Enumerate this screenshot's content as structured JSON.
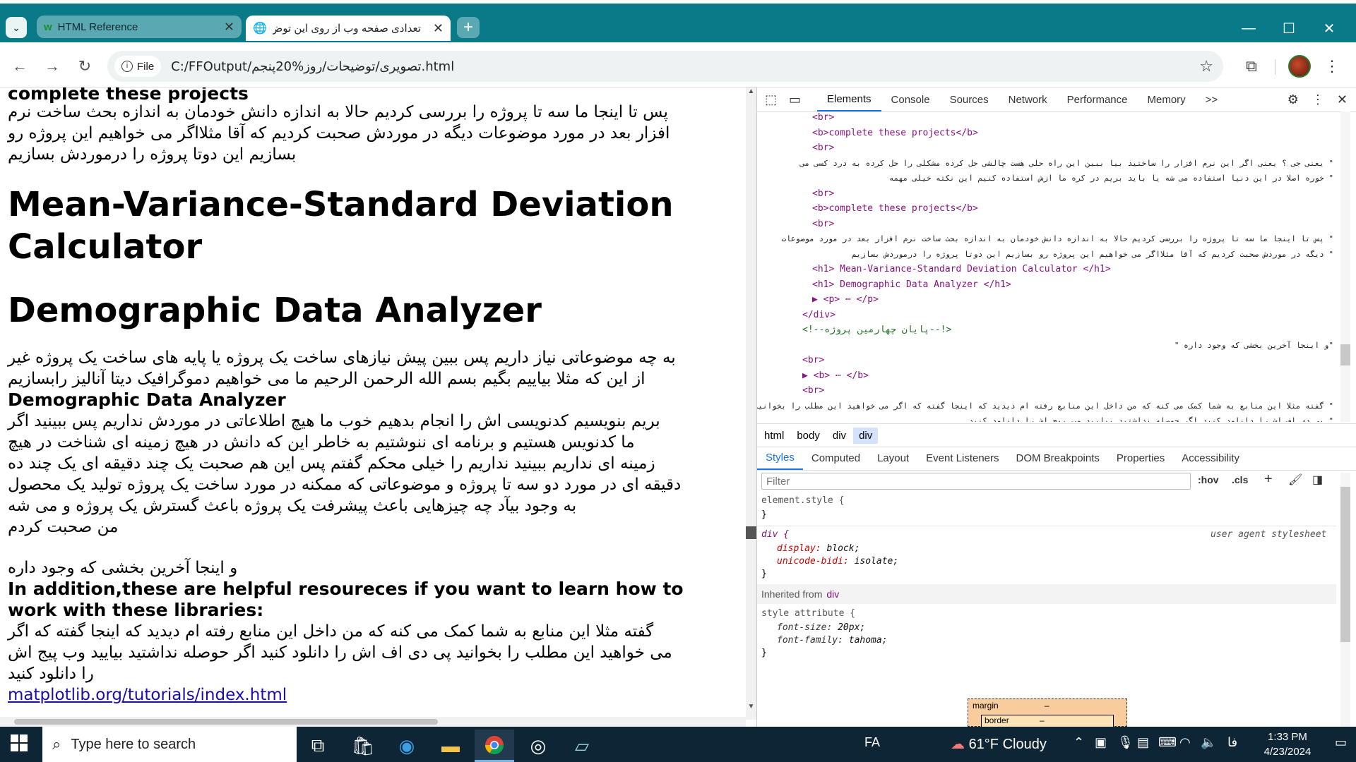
{
  "browser": {
    "tabs": [
      {
        "title": "HTML Reference",
        "active": false
      },
      {
        "title": "تعدادی صفحه وب از روی این توض",
        "active": true
      }
    ],
    "file_chip": "File",
    "url": "C:/FFOutput/تصویری/توضیحات/روز%20پنجم.html"
  },
  "page": {
    "lines": [
      {
        "kind": "b",
        "text": "complete these projects"
      },
      {
        "kind": "p",
        "text": "پس تا اینجا ما سه تا پروژه را بررسی کردیم حالا به اندازه دانش خودمان به اندازه بحث ساخت نرم"
      },
      {
        "kind": "p",
        "text": "افزار بعد در مورد موضوعات دیگه در موردش صحبت کردیم که آقا مثلااگر می خواهیم این پروژه رو"
      },
      {
        "kind": "p",
        "text": "بسازیم این دوتا پروژه را درموردش بسازیم"
      }
    ],
    "h1_1": "Mean-Variance-Standard Deviation Calculator",
    "h1_2": "Demographic Data Analyzer",
    "para1": [
      "به چه موضوعاتی نیاز داریم پس ببین پیش نیازهای ساخت یک پروژه یا پایه های ساخت یک پروژه غیر",
      "از این که مثلا بیاییم بگیم بسم الله الرحمن الرحیم ما می خواهیم دموگرافیک دیتا آنالیز رابسازیم"
    ],
    "b2": "Demographic Data Analyzer",
    "para2": [
      "بریم بنویسیم کدنویسی اش را انجام بدهیم خوب ما هیچ اطلاعاتی در موردش نداریم پس ببینید اگر",
      "ما کدنویس هستیم و برنامه ای ننوشتیم به خاطر این که دانش در هیچ زمینه ای شناخت در هیچ",
      "زمینه ای نداریم ببینید نداریم را خیلی محکم گفتم پس این هم صحبت یک چند دقیقه ای یک چند ده",
      "دقیقه ای در مورد دو سه تا پروژه و موضوعاتی که ممکنه در مورد ساخت یک پروژه تولید یک محصول",
      "به وجود بیآد چه چیزهایی باعث پیشرفت یک پروژه باعث گسترش یک پروژه و می شه",
      "من صحبت کردم"
    ],
    "para3": "و اینجا آخرین بخشی که وجود داره",
    "b3": "In addition,these are helpful resoureces if you want to learn how to work with these libraries:",
    "para4": [
      "گفته مثلا این منابع به شما کمک می کنه که من داخل این منابع رفته ام دیدید که اینجا گفته که اگر",
      "می خواهید این مطلب را بخوانید پی دی اف اش را دانلود کنید اگر حوصله نداشتید بیایید وب پیج اش",
      "را دانلود کنید"
    ],
    "link": "matplotlib.org/tutorials/index.html"
  },
  "devtools": {
    "tabs": [
      "Elements",
      "Console",
      "Sources",
      "Network",
      "Performance",
      "Memory"
    ],
    "more": ">>",
    "dom": [
      {
        "indent": 0,
        "cls": "tag",
        "text": "<br>"
      },
      {
        "indent": 0,
        "cls": "tag",
        "text": "<b>complete these projects</b>"
      },
      {
        "indent": 0,
        "cls": "tag",
        "text": "<br>"
      },
      {
        "indent": 0,
        "cls": "txt",
        "text": "\" یعنی جی ؟ یعنی اگر این نرم افزار را ساختید بیا ببین این راه حلی هست چالشی حل کرده مشکلی را حل کرده به درد کسی می"
      },
      {
        "indent": 0,
        "cls": "txt",
        "text": "\" خوره اصلا در این دنیا استفاده می شه یا باید بریم در کره ما ازش استفاده کنیم این نکته خیلی مهمه"
      },
      {
        "indent": 0,
        "cls": "tag",
        "text": "<br>"
      },
      {
        "indent": 0,
        "cls": "tag",
        "text": "<b>complete these projects</b>"
      },
      {
        "indent": 0,
        "cls": "tag",
        "text": "<br>"
      },
      {
        "indent": 0,
        "cls": "txt",
        "text": "\" پس تا اینجا ما سه تا پروژه را بررسی کردیم حالا به اندازه دانش خودمان به اندازه بحث ساخت نرم افزار بعد در مورد موضوعات"
      },
      {
        "indent": 0,
        "cls": "txt",
        "text": "\" دیگه در موردش صحبت کردیم که آقا مثلااگر می خواهیم این پروژه رو بسازیم این دوتا پروژه را درموردش بسازیم"
      },
      {
        "indent": 0,
        "cls": "tag",
        "text": "<h1> Mean-Variance-Standard Deviation Calculator </h1>"
      },
      {
        "indent": 0,
        "cls": "tag",
        "text": "<h1> Demographic Data Analyzer </h1>"
      },
      {
        "indent": 0,
        "cls": "tag",
        "text": "▶ <p> ⋯ </p>"
      },
      {
        "indent": -1,
        "cls": "tag",
        "text": "</div>"
      },
      {
        "indent": -1,
        "cls": "cmt",
        "text": "<!--پایان چهارمین پروژه--!>"
      },
      {
        "indent": -1,
        "cls": "txt",
        "text": "\"و اینجا آخرین بخشی که وجود داره \""
      },
      {
        "indent": -1,
        "cls": "tag",
        "text": "<br>"
      },
      {
        "indent": -1,
        "cls": "tag",
        "text": "▶ <b> ⋯ </b>"
      },
      {
        "indent": -1,
        "cls": "tag",
        "text": "<br>"
      },
      {
        "indent": -1,
        "cls": "txt",
        "text": "\" گفته مثلا این منابع به شما کمک می کنه که من داخل این منابع رفته ام دیدید که اینجا گفته که اگر می خواهید این مطلب را بخوانید"
      },
      {
        "indent": -1,
        "cls": "txt",
        "text": "\" پی دی اف اش را دانلود کنید اگر حوصله نداشتید بیایید وب پیج اش را دانلود کنید"
      }
    ],
    "breadcrumbs": [
      "html",
      "body",
      "div",
      "div"
    ],
    "style_tabs": [
      "Styles",
      "Computed",
      "Layout",
      "Event Listeners",
      "DOM Breakpoints",
      "Properties",
      "Accessibility"
    ],
    "filter_placeholder": "Filter",
    "hov": ":hov",
    "cls": ".cls",
    "rules": {
      "element_style": "element.style {",
      "close": "}",
      "div_selector": "div {",
      "ua": "user agent stylesheet",
      "display_prop": "display:",
      "display_val": "block;",
      "bidi_prop": "unicode-bidi:",
      "bidi_val": "isolate;",
      "inherited_label": "Inherited from",
      "inherited_el": "div",
      "style_attr": "style attribute {",
      "fs_prop": "font-size:",
      "fs_val": "20px;",
      "ff_prop": "font-family:",
      "ff_val": "tahoma;"
    },
    "boxmodel": {
      "margin": "margin",
      "dash": "–",
      "border": "border"
    }
  },
  "taskbar": {
    "search_placeholder": "Type here to search",
    "lang": "FA",
    "weather": "61°F  Cloudy",
    "time": "1:33 PM",
    "date": "4/23/2024",
    "ime": "فا"
  },
  "colors": {
    "accent": "#0a7a88",
    "taskbar": "#0e2536"
  }
}
